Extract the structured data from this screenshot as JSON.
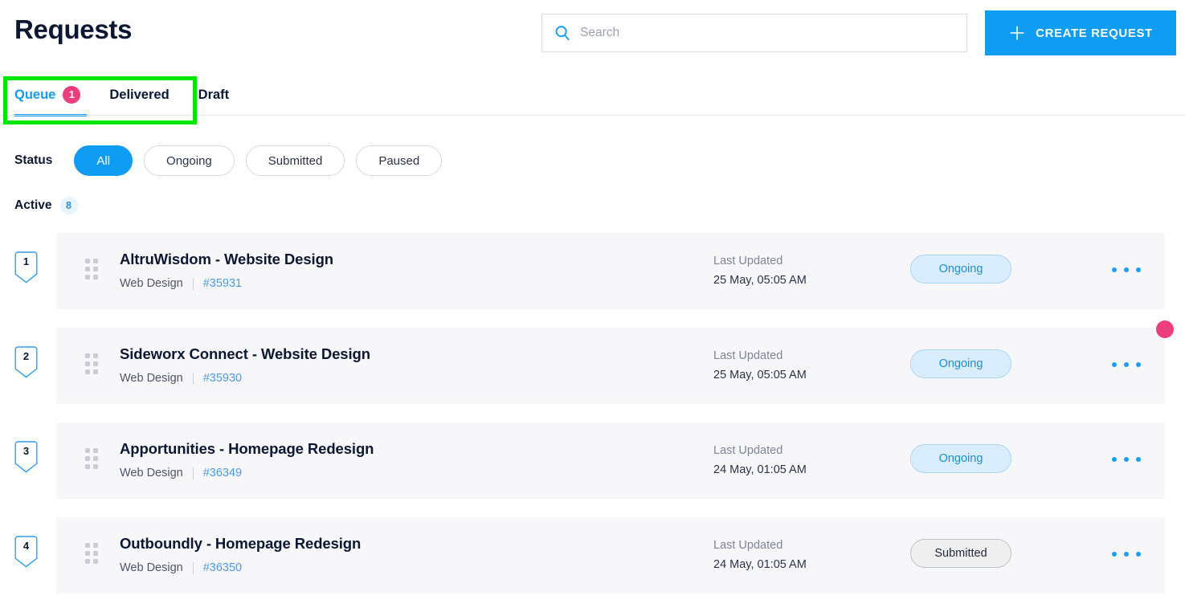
{
  "header": {
    "title": "Requests",
    "search": {
      "placeholder": "Search",
      "value": "",
      "icon": "search-icon"
    },
    "create_button": {
      "label": "CREATE REQUEST",
      "icon": "plus-icon",
      "color": "#0f9cf3"
    }
  },
  "tabs": [
    {
      "label": "Queue",
      "badge": "1",
      "active": true
    },
    {
      "label": "Delivered",
      "badge": "",
      "active": false
    },
    {
      "label": "Draft",
      "badge": "",
      "active": false
    }
  ],
  "filters": {
    "status_label": "Status",
    "options": [
      {
        "label": "All",
        "selected": true
      },
      {
        "label": "Ongoing",
        "selected": false
      },
      {
        "label": "Submitted",
        "selected": false
      },
      {
        "label": "Paused",
        "selected": false
      }
    ]
  },
  "active_section": {
    "label": "Active",
    "count": "8"
  },
  "requests": [
    {
      "rank": "1",
      "title": "AltruWisdom - Website Design",
      "category": "Web Design",
      "id": "#35931",
      "updated_label": "Last Updated",
      "updated_value": "25 May, 05:05 AM",
      "status": "Ongoing",
      "status_kind": "ongoing"
    },
    {
      "rank": "2",
      "title": "Sideworx Connect - Website Design",
      "category": "Web Design",
      "id": "#35930",
      "updated_label": "Last Updated",
      "updated_value": "25 May, 05:05 AM",
      "status": "Ongoing",
      "status_kind": "ongoing"
    },
    {
      "rank": "3",
      "title": "Apportunities - Homepage Redesign",
      "category": "Web Design",
      "id": "#36349",
      "updated_label": "Last Updated",
      "updated_value": "24 May, 01:05 AM",
      "status": "Ongoing",
      "status_kind": "ongoing"
    },
    {
      "rank": "4",
      "title": "Outboundly - Homepage Redesign",
      "category": "Web Design",
      "id": "#36350",
      "updated_label": "Last Updated",
      "updated_value": "24 May, 01:05 AM",
      "status": "Submitted",
      "status_kind": "submitted"
    }
  ],
  "annotations": {
    "highlight_color": "#00e800",
    "marker_color": "#ec3e7d"
  }
}
